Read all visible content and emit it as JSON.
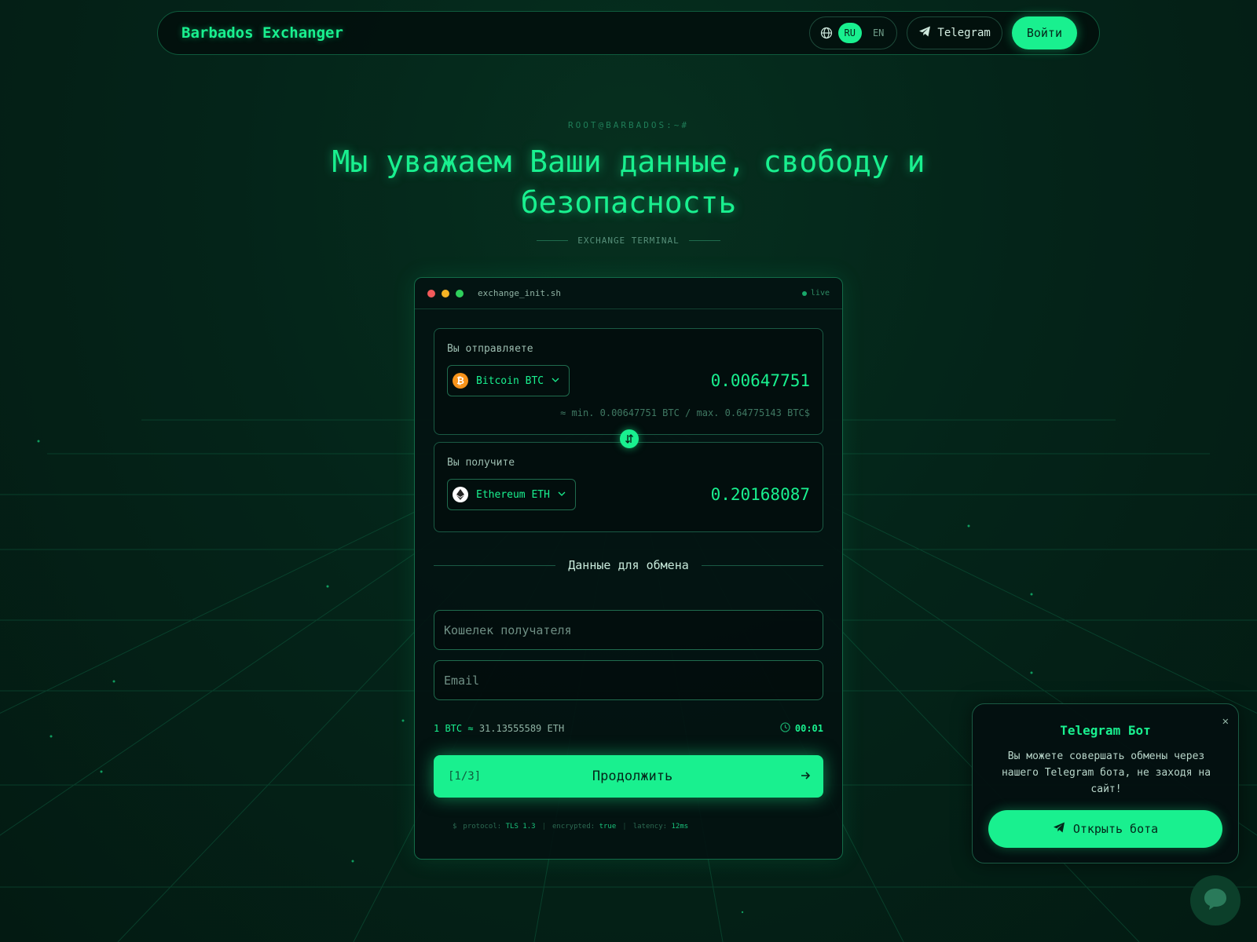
{
  "header": {
    "brand": "Barbados Exchanger",
    "languages": [
      "RU",
      "EN"
    ],
    "active_language": "RU",
    "telegram_label": "Telegram",
    "login_label": "Войти"
  },
  "hero": {
    "prompt": "ROOT@BARBADOS:~#",
    "title": "Мы уважаем Ваши данные, свободу и безопасность",
    "subtitle": "EXCHANGE TERMINAL"
  },
  "terminal": {
    "filename": "exchange_init.sh",
    "status": "live",
    "send": {
      "label": "Вы отправляете",
      "currency": "Bitcoin BTC",
      "amount": "0.00647751",
      "limits": "≈ min. 0.00647751 BTC / max. 0.64775143 BTC$"
    },
    "receive": {
      "label": "Вы получите",
      "currency": "Ethereum ETH",
      "amount": "0.20168087"
    },
    "section_title": "Данные для обмена",
    "wallet_placeholder": "Кошелек получателя",
    "email_placeholder": "Email",
    "rate_prefix": "1 BTC ≈",
    "rate_value": "31.13555589 ETH",
    "timer": "00:01",
    "step": "[1/3]",
    "continue_label": "Продолжить",
    "status_line": {
      "prompt": "$",
      "protocol_key": "protocol:",
      "protocol_val": "TLS 1.3",
      "encrypted_key": "encrypted:",
      "encrypted_val": "true",
      "latency_key": "latency:",
      "latency_val": "12ms"
    }
  },
  "telegram_popup": {
    "title": "Telegram Бот",
    "text": "Вы можете совершать обмены через нашего Telegram бота, не заходя на сайт!",
    "button_label": "Открыть бота"
  },
  "icons": {
    "globe": "globe-icon",
    "telegram": "telegram-plane-icon",
    "swap": "swap-arrows-icon",
    "clock": "clock-icon",
    "chat": "chat-bubble-icon"
  },
  "colors": {
    "accent": "#19f08f",
    "background": "#042419",
    "btc": "#f7931a"
  }
}
